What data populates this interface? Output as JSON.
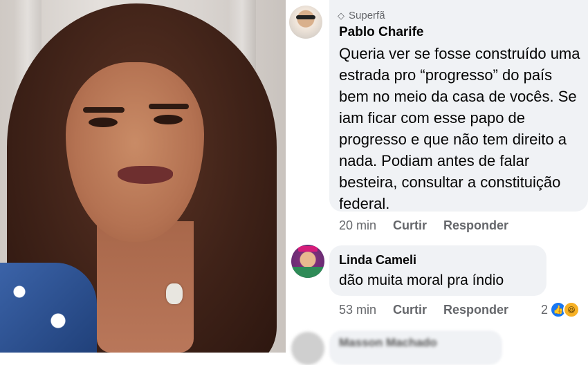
{
  "comments": [
    {
      "badge": "Superfã",
      "author": "Pablo Charife",
      "text": "Queria ver se fosse construído uma estrada pro “progresso” do país bem no meio da casa de vocês. Se iam ficar com esse papo de progresso e que não tem direito a nada. Podiam antes de falar besteira, consultar a constituição federal.",
      "time": "20 min",
      "like_label": "Curtir",
      "reply_label": "Responder"
    },
    {
      "author": "Linda Cameli",
      "text": "dão muita moral pra índio",
      "time": "53 min",
      "like_label": "Curtir",
      "reply_label": "Responder",
      "reaction_count": "2"
    },
    {
      "author": "Masson Machado"
    }
  ],
  "icons": {
    "badge": "diamond-icon",
    "reactions": [
      "like-reaction-icon",
      "haha-reaction-icon"
    ]
  },
  "colors": {
    "bubble": "#f0f2f5",
    "secondary_text": "#65676b",
    "like_blue": "#1877f2"
  }
}
